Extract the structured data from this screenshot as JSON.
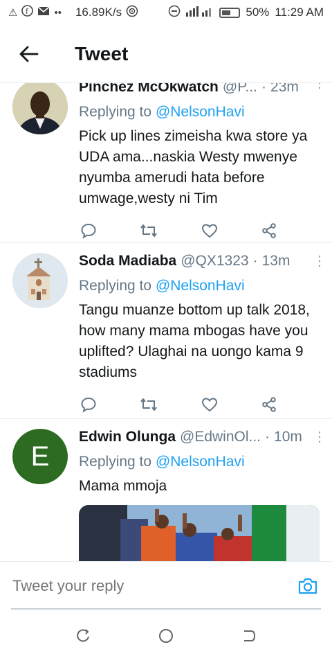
{
  "status_bar": {
    "speed": "16.89K/s",
    "battery": "50%",
    "time": "11:29 AM"
  },
  "header": {
    "title": "Tweet"
  },
  "tweets": [
    {
      "name": "Pinchez McOkwatch",
      "handle": "@P...",
      "time": "23m",
      "replying_prefix": "Replying to",
      "replying_to": "@NelsonHavi",
      "text": "Pick up lines zimeisha kwa store ya UDA ama...naskia Westy mwenye nyumba amerudi hata before umwage,westy ni Tim"
    },
    {
      "name": "Soda Madiaba",
      "handle": "@QX1323",
      "time": "13m",
      "replying_prefix": "Replying to",
      "replying_to": "@NelsonHavi",
      "text": "Tangu muanze bottom up talk 2018, how many mama mbogas have you uplifted? Ulaghai na uongo kama 9 stadiums"
    },
    {
      "name": "Edwin Olunga",
      "handle": "@EdwinOl...",
      "time": "10m",
      "avatar_letter": "E",
      "avatar_color": "#2e6b22",
      "replying_prefix": "Replying to",
      "replying_to": "@NelsonHavi",
      "text": "Mama mmoja"
    }
  ],
  "reply_bar": {
    "placeholder": "Tweet your reply"
  },
  "colors": {
    "accent": "#1da1f2",
    "secondary_text": "#657786"
  }
}
